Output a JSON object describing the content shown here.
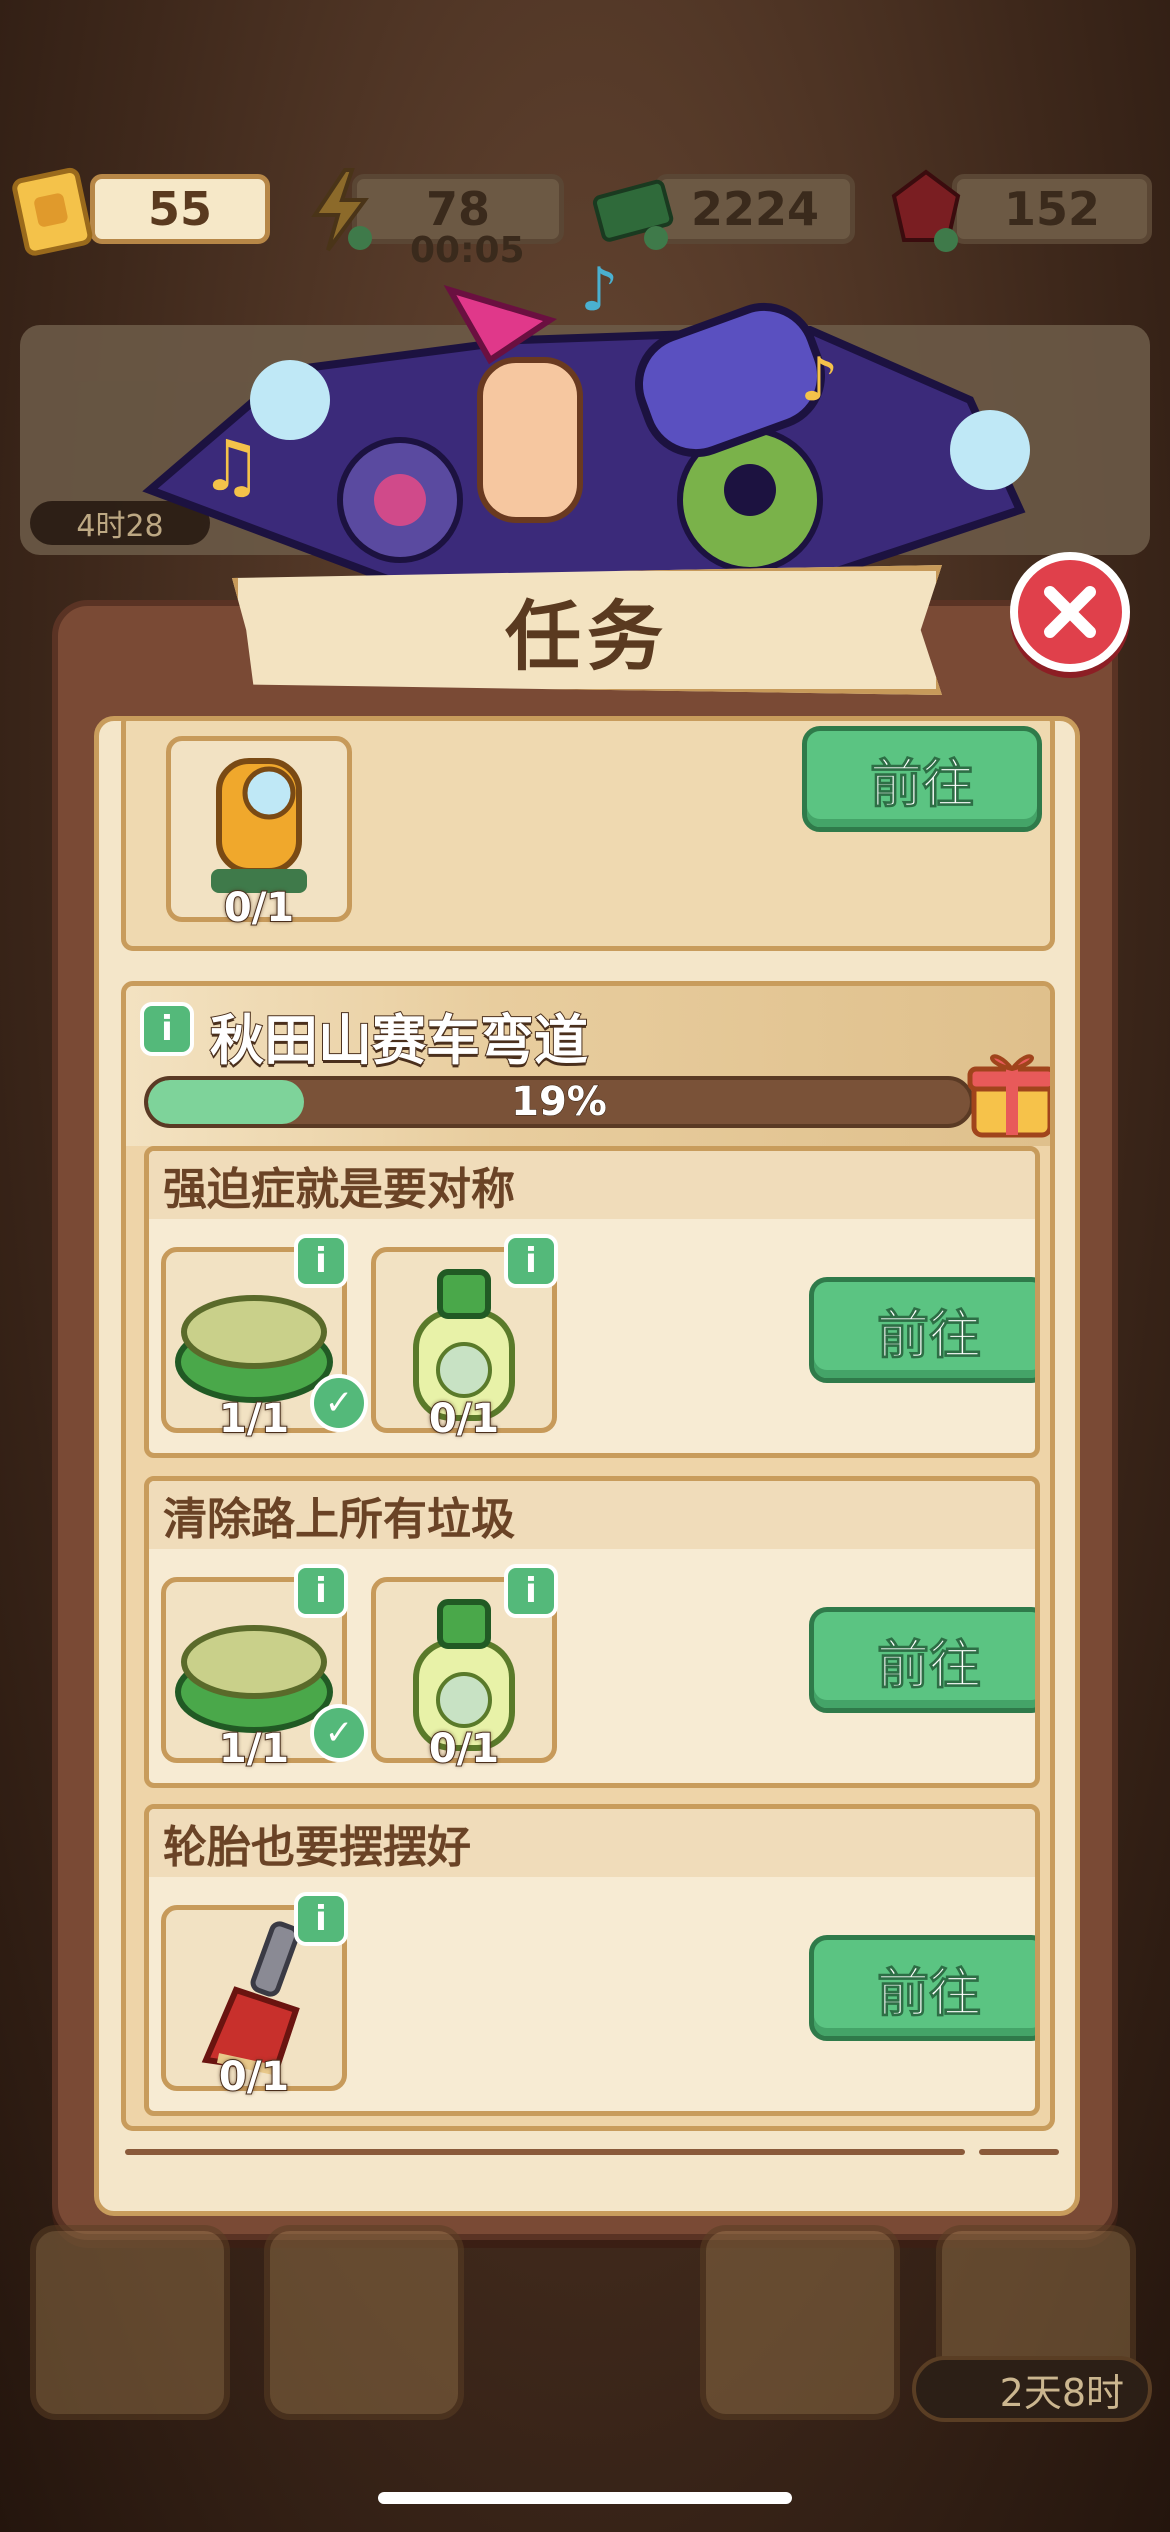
{
  "resources": {
    "ticket": "55",
    "energy": "78",
    "energy_timer": "00:05",
    "cash": "2224",
    "gems": "152"
  },
  "background": {
    "banner_timer": "4时28",
    "season_timer": "2天8时"
  },
  "panel": {
    "title": "任务",
    "top_task": {
      "item_count": "0/1",
      "button": "前往"
    },
    "road": {
      "name": "秋田山赛车弯道",
      "progress_text": "19%",
      "progress_value": 0.19,
      "tasks": [
        {
          "title": "强迫症就是要对称",
          "items": [
            {
              "icon": "sponge-icon",
              "count": "1/1",
              "done": true
            },
            {
              "icon": "soap-bottle-icon",
              "count": "0/1",
              "done": false
            }
          ],
          "button": "前往"
        },
        {
          "title": "清除路上所有垃圾",
          "items": [
            {
              "icon": "sponge-icon",
              "count": "1/1",
              "done": true
            },
            {
              "icon": "soap-bottle-icon",
              "count": "0/1",
              "done": false
            }
          ],
          "button": "前往"
        },
        {
          "title": "轮胎也要摆摆好",
          "items": [
            {
              "icon": "brush-icon",
              "count": "0/1",
              "done": false
            }
          ],
          "button": "前往"
        }
      ]
    }
  },
  "colors": {
    "go_button": "#5bc482",
    "close_button": "#e0404b",
    "panel_frame": "#7a4a35",
    "progress_fill": "#7ed39a"
  }
}
